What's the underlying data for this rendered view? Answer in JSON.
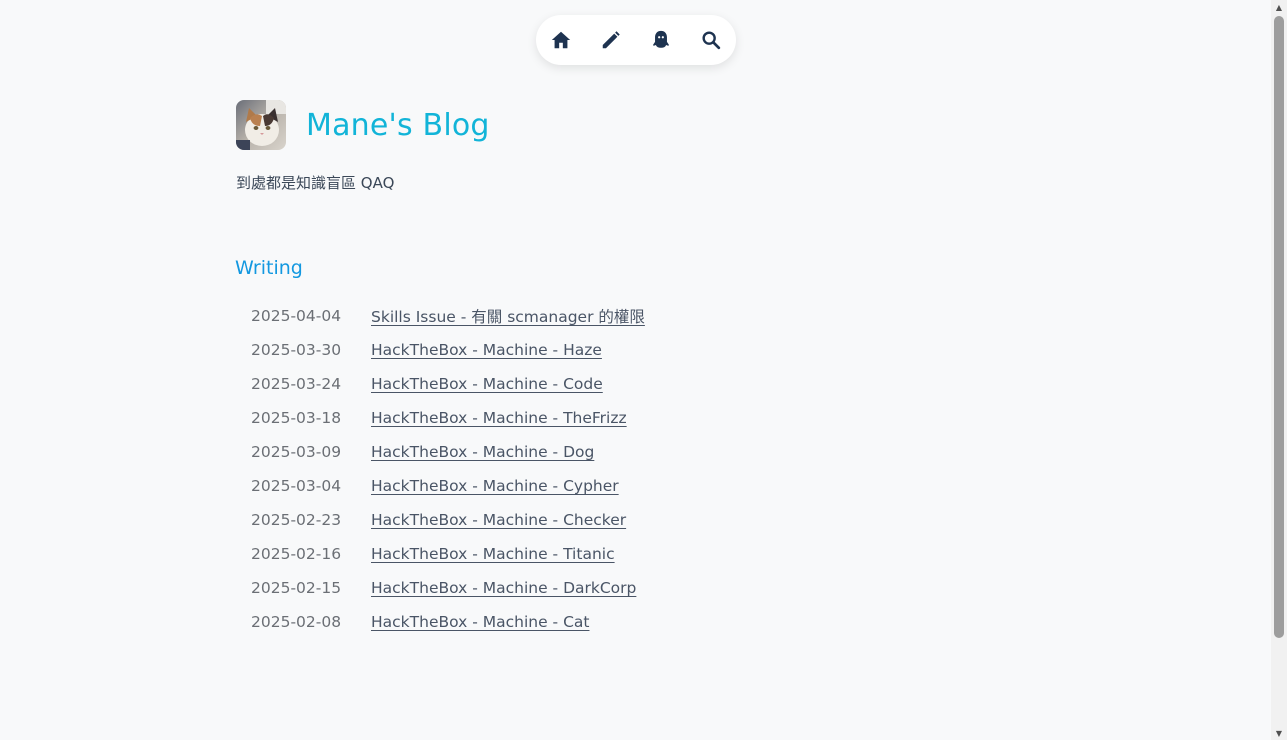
{
  "nav": {
    "items": [
      {
        "icon": "home-icon"
      },
      {
        "icon": "pencil-icon"
      },
      {
        "icon": "ghost-icon"
      },
      {
        "icon": "search-icon"
      }
    ]
  },
  "site": {
    "title": "Mane's Blog",
    "tagline": "到處都是知識盲區 QAQ",
    "avatar": "cat-avatar",
    "accent_color": "#12b4d8"
  },
  "section": {
    "title": "Writing",
    "color": "#1398e0"
  },
  "posts": [
    {
      "date": "2025-04-04",
      "title": "Skills Issue - 有關 scmanager 的權限"
    },
    {
      "date": "2025-03-30",
      "title": "HackTheBox - Machine - Haze"
    },
    {
      "date": "2025-03-24",
      "title": "HackTheBox - Machine - Code"
    },
    {
      "date": "2025-03-18",
      "title": "HackTheBox - Machine - TheFrizz"
    },
    {
      "date": "2025-03-09",
      "title": "HackTheBox - Machine - Dog"
    },
    {
      "date": "2025-03-04",
      "title": "HackTheBox - Machine - Cypher"
    },
    {
      "date": "2025-02-23",
      "title": "HackTheBox - Machine - Checker"
    },
    {
      "date": "2025-02-16",
      "title": "HackTheBox - Machine - Titanic"
    },
    {
      "date": "2025-02-15",
      "title": "HackTheBox - Machine - DarkCorp"
    },
    {
      "date": "2025-02-08",
      "title": "HackTheBox - Machine - Cat"
    }
  ]
}
